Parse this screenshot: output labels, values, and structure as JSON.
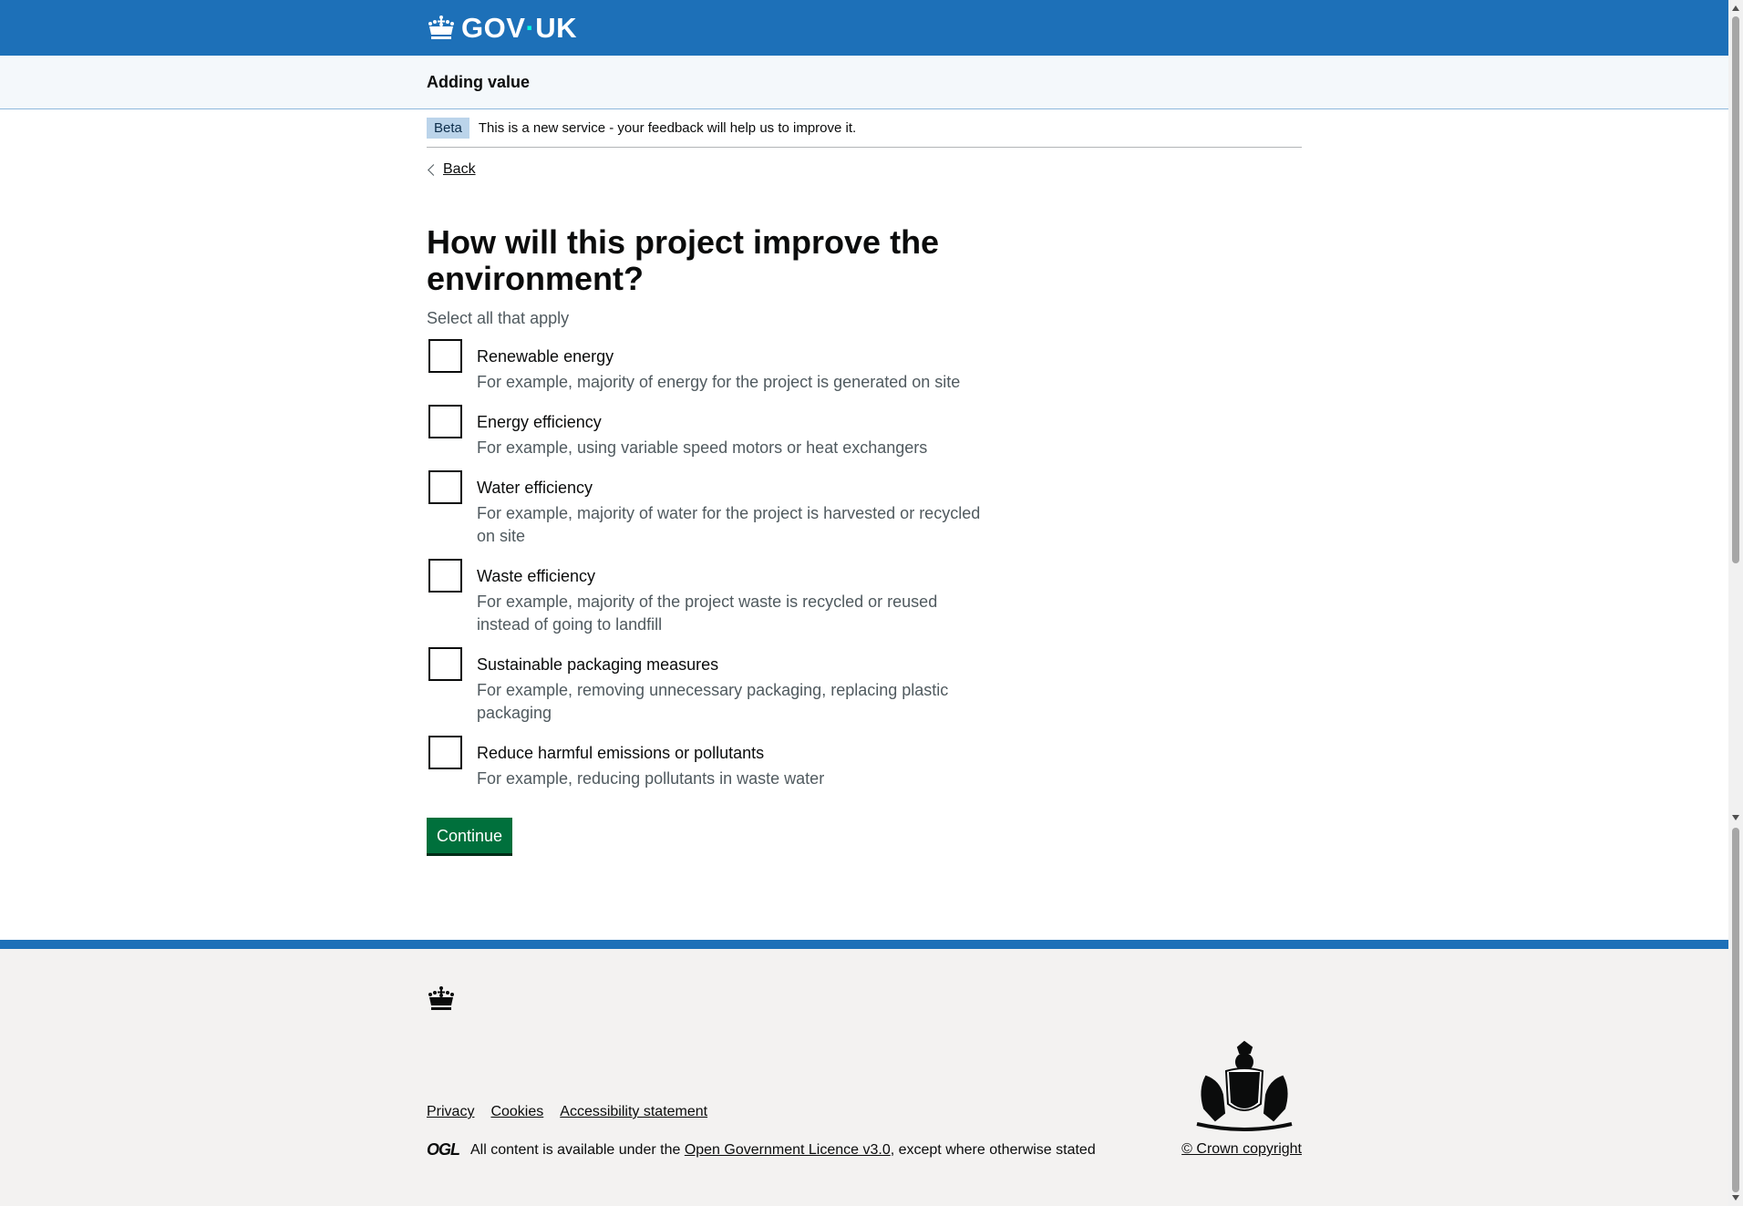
{
  "header": {
    "logo_text_left": "GOV",
    "logo_dot": "·",
    "logo_text_right": "UK",
    "logo_icon": "crown-icon"
  },
  "service": {
    "name": "Adding value"
  },
  "phase": {
    "tag": "Beta",
    "text": "This is a new service - your feedback will help us to improve it."
  },
  "nav": {
    "back_label": "Back"
  },
  "question": {
    "title": "How will this project improve the environment?",
    "hint": "Select all that apply",
    "options": [
      {
        "label": "Renewable energy",
        "hint": "For example, majority of energy for the project is generated on site",
        "checked": false
      },
      {
        "label": "Energy efficiency",
        "hint": "For example, using variable speed motors or heat exchangers",
        "checked": false
      },
      {
        "label": "Water efficiency",
        "hint": "For example, majority of water for the project is harvested or recycled on site",
        "checked": false
      },
      {
        "label": "Waste efficiency",
        "hint": "For example, majority of the project waste is recycled or reused instead of going to landfill",
        "checked": false
      },
      {
        "label": "Sustainable packaging measures",
        "hint": "For example, removing unnecessary packaging, replacing plastic packaging",
        "checked": false
      },
      {
        "label": "Reduce harmful emissions or pollutants",
        "hint": "For example, reducing pollutants in waste water",
        "checked": false
      }
    ],
    "continue_label": "Continue"
  },
  "footer": {
    "links": [
      "Privacy",
      "Cookies",
      "Accessibility statement"
    ],
    "ogl_logo": "OGL",
    "licence_prefix": "All content is available under the ",
    "licence_link": "Open Government Licence v3.0",
    "licence_suffix": ", except where otherwise stated",
    "copyright": "© Crown copyright",
    "icons": [
      "crown-icon",
      "royal-coat-of-arms-icon"
    ]
  },
  "colors": {
    "header_blue": "#1d70b8",
    "button_green": "#00703c",
    "text": "#0b0c0c",
    "hint": "#505a5f",
    "beta_tag_bg": "#bbd4ea"
  }
}
